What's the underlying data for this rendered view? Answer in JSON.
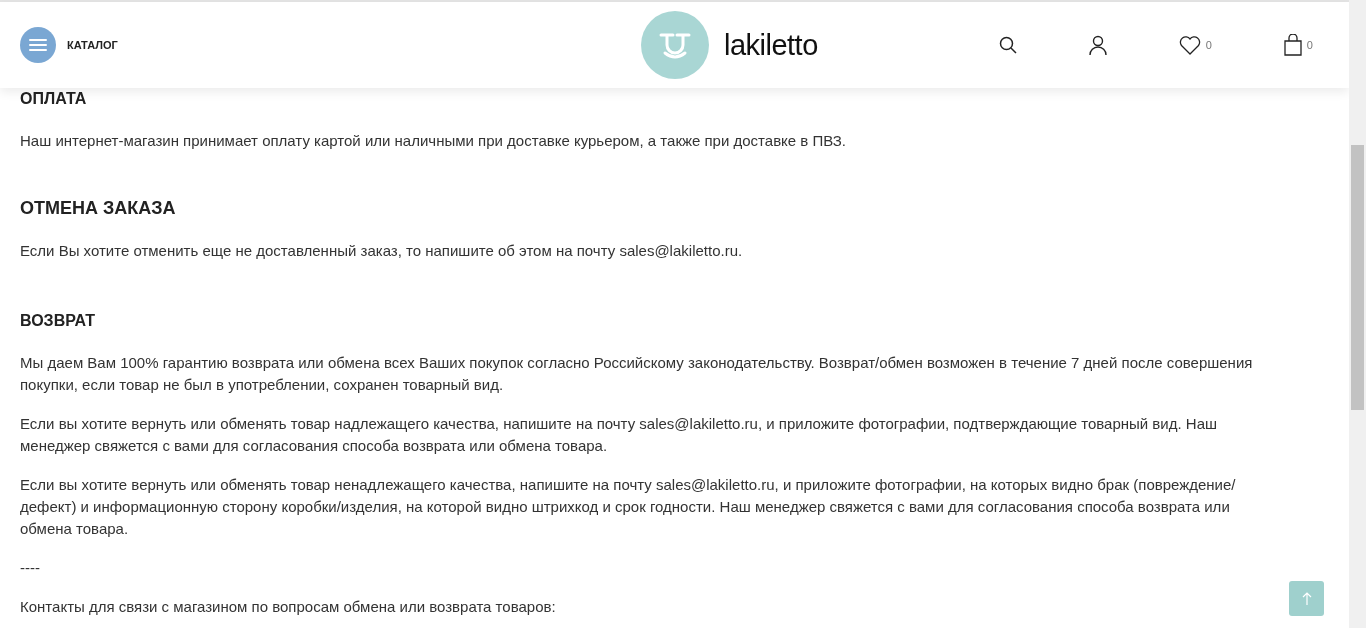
{
  "header": {
    "menu_label": "КАТАЛОГ",
    "logo_text": "lakiletto",
    "wishlist_count": "0",
    "cart_count": "0"
  },
  "blocks": [
    {
      "kind": "heading-small",
      "text": "ОПЛАТА"
    },
    {
      "kind": "paragraph",
      "text": "Наш интернет-магазин принимает оплату картой или наличными при доставке курьером, а также при доставке в ПВЗ."
    },
    {
      "kind": "heading",
      "text": "ОТМЕНА ЗАКАЗА"
    },
    {
      "kind": "paragraph",
      "text": "Если Вы хотите отменить еще не доставленный заказ, то напишите об этом на почту sales@lakiletto.ru."
    },
    {
      "kind": "heading-small",
      "text": "ВОЗВРАТ"
    },
    {
      "kind": "paragraph",
      "text": "Мы даем Вам 100% гарантию возврата или обмена всех Ваших покупок согласно Российскому законодательству. Возврат/обмен возможен в течение 7 дней после совершения покупки, если товар не был в употреблении, сохранен товарный вид."
    },
    {
      "kind": "paragraph",
      "text": "Если вы хотите вернуть или обменять товар надлежащего качества, напишите на почту sales@lakiletto.ru, и приложите фотографии, подтверждающие товарный вид. Наш менеджер свяжется с вами для согласования способа возврата или обмена товара."
    },
    {
      "kind": "paragraph",
      "text": "Если вы хотите вернуть или обменять товар ненадлежащего качества, напишите на почту sales@lakiletto.ru, и приложите фотографии, на которых видно брак (повреждение/дефект) и информационную сторону коробки/изделия, на которой видно штрихкод и срок годности. Наш менеджер свяжется с вами для согласования способа возврата или обмена товара."
    },
    {
      "kind": "separator",
      "text": "----"
    },
    {
      "kind": "paragraph",
      "text": "Контакты для связи с магазином по вопросам обмена или возврата товаров:"
    }
  ]
}
